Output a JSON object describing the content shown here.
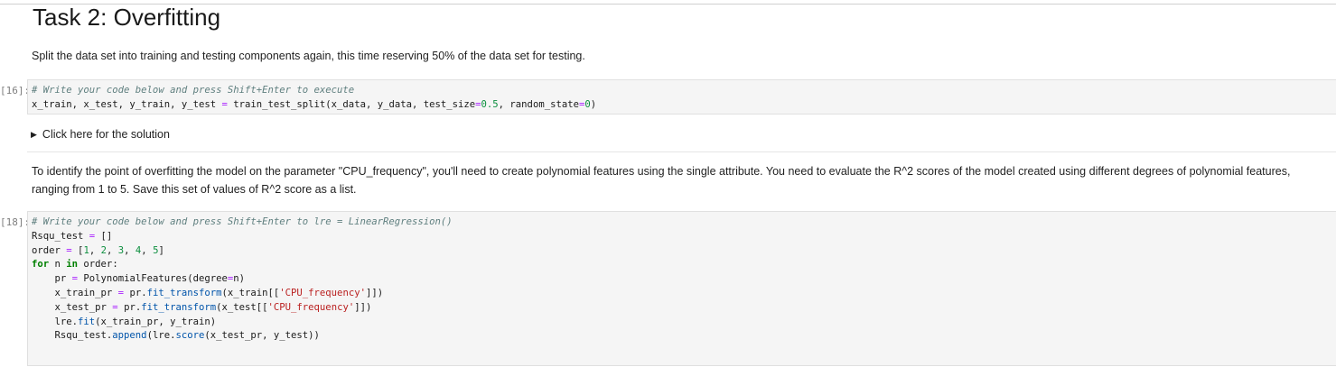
{
  "heading": {
    "title": "Task 2: Overfitting"
  },
  "markdown_1": {
    "text": "Split the data set into training and testing components again, this time reserving 50% of the data set for testing."
  },
  "cell_1": {
    "prompt": "[16]:",
    "comment": "# Write your code below and press Shift+Enter to execute",
    "line_2": "x_train, x_test, y_train, y_test = train_test_split(x_data, y_data, test_size=0.5, random_state=0)"
  },
  "solution": {
    "toggle_icon": "triangle-right-icon",
    "label": "Click here for the solution"
  },
  "markdown_2": {
    "text": "To identify the point of overfitting the model on the parameter \"CPU_frequency\", you'll need to create polynomial features using the single attribute. You need to evaluate the R^2 scores of the model created using different degrees of polynomial features, ranging from 1 to 5. Save this set of values of R^2 score as a list."
  },
  "cell_2": {
    "prompt": "[18]:",
    "lines": [
      "# Write your code below and press Shift+Enter to lre = LinearRegression()",
      "Rsqu_test = []",
      "order = [1, 2, 3, 4, 5]",
      "for n in order:",
      "    pr = PolynomialFeatures(degree=n)",
      "    x_train_pr = pr.fit_transform(x_train[['CPU_frequency']])",
      "    x_test_pr = pr.fit_transform(x_test[['CPU_frequency']])",
      "    lre.fit(x_train_pr, y_train)",
      "    Rsqu_test.append(lre.score(x_test_pr, y_test))"
    ]
  },
  "colors": {
    "code_background": "#f5f5f5",
    "comment": "#5f7f7f",
    "keyword": "#008000",
    "number": "#0d8f3f",
    "string": "#ba2121",
    "prompt": "#7f7f7f"
  }
}
